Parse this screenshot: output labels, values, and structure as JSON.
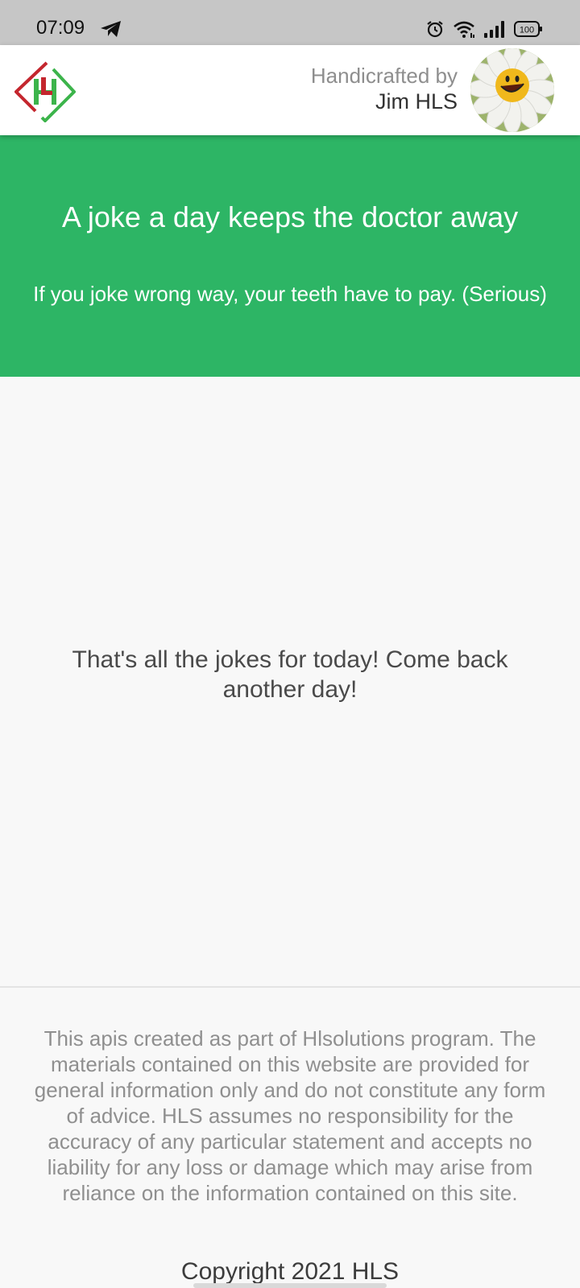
{
  "status_bar": {
    "time": "07:09",
    "battery": "100",
    "icons": [
      "telegram-icon",
      "alarm-icon",
      "wifi-icon",
      "signal-icon",
      "battery-icon"
    ]
  },
  "header": {
    "logo_icon": "hls-logo",
    "credit_label": "Handicrafted by",
    "credit_name": "Jim HLS",
    "avatar_icon": "smiling-daisy-avatar"
  },
  "hero": {
    "title": "A joke a day keeps the doctor away",
    "subtitle": "If you joke wrong way, your teeth have to pay. (Serious)"
  },
  "main": {
    "message": "That's all the jokes for today! Come back another day!"
  },
  "footer": {
    "disclaimer": "This apis created as part of Hlsolutions program. The materials contained on this website are provided for general information only and do not constitute any form of advice. HLS assumes no responsibility for the accuracy of any particular statement and accepts no liability for any loss or damage which may arise from reliance on the information contained on this site.",
    "copyright": "Copyright 2021 HLS"
  },
  "colors": {
    "hero_background": "#2db565",
    "page_background": "#f8f8f8",
    "status_bar_background": "#c6c6c6",
    "logo_red": "#c4262e",
    "logo_green": "#3cb44b"
  }
}
